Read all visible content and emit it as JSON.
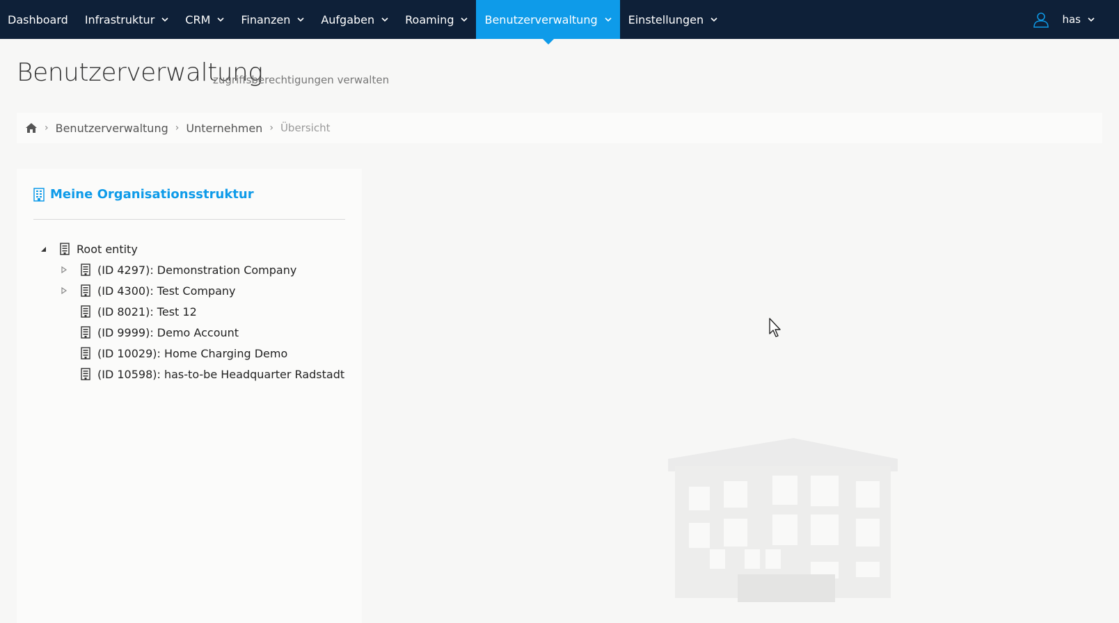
{
  "nav": {
    "items": [
      {
        "label": "Dashboard",
        "has_menu": false,
        "active": false
      },
      {
        "label": "Infrastruktur",
        "has_menu": true,
        "active": false
      },
      {
        "label": "CRM",
        "has_menu": true,
        "active": false
      },
      {
        "label": "Finanzen",
        "has_menu": true,
        "active": false
      },
      {
        "label": "Aufgaben",
        "has_menu": true,
        "active": false
      },
      {
        "label": "Roaming",
        "has_menu": true,
        "active": false
      },
      {
        "label": "Benutzerverwaltung",
        "has_menu": true,
        "active": true
      },
      {
        "label": "Einstellungen",
        "has_menu": true,
        "active": false
      }
    ],
    "user": {
      "name": "has",
      "icon": "user-icon"
    }
  },
  "page": {
    "title": "Benutzerverwaltung",
    "subtitle": "zugriffsberechtigungen verwalten"
  },
  "breadcrumb": {
    "home_icon": "home-icon",
    "items": [
      "Benutzerverwaltung",
      "Unternehmen"
    ],
    "current": "Übersicht"
  },
  "panel": {
    "title": "Meine Organisationsstruktur",
    "icon": "building-icon",
    "tree": {
      "root": {
        "label": "Root entity",
        "expanded": true
      },
      "children": [
        {
          "label": "(ID 4297): Demonstration Company",
          "expandable": true
        },
        {
          "label": "(ID 4300): Test Company",
          "expandable": true
        },
        {
          "label": "(ID 8021): Test 12",
          "expandable": false
        },
        {
          "label": "(ID 9999): Demo Account",
          "expandable": false
        },
        {
          "label": "(ID 10029): Home Charging Demo",
          "expandable": false
        },
        {
          "label": "(ID 10598): has-to-be Headquarter Radstadt",
          "expandable": false
        }
      ]
    }
  },
  "colors": {
    "nav_bg": "#0e2038",
    "accent": "#0e9be9",
    "page_bg": "#f7f7f6"
  }
}
